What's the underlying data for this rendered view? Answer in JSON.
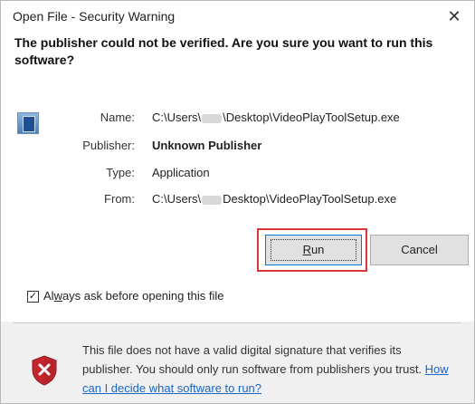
{
  "window": {
    "title": "Open File - Security Warning",
    "close_glyph": "✕"
  },
  "headline": "The publisher could not be verified.  Are you sure you want to run this software?",
  "info": {
    "name_label": "Name:",
    "name_prefix": "C:\\Users\\",
    "name_suffix": "\\Desktop\\VideoPlayToolSetup.exe",
    "publisher_label": "Publisher:",
    "publisher_value": "Unknown Publisher",
    "type_label": "Type:",
    "type_value": "Application",
    "from_label": "From:",
    "from_prefix": "C:\\Users\\",
    "from_suffix": "Desktop\\VideoPlayToolSetup.exe"
  },
  "buttons": {
    "run_accel": "R",
    "run_rest": "un",
    "cancel_label": "Cancel"
  },
  "checkbox": {
    "checked_glyph": "✓",
    "label_part1": "Al",
    "label_accel": "w",
    "label_part2": "ays ask before opening this file"
  },
  "warning": {
    "text": "This file does not have a valid digital signature that verifies its publisher.  You should only run software from publishers you trust.",
    "link": "How can I decide what software to run?"
  },
  "colors": {
    "highlight": "#e23636",
    "link": "#1a66c7",
    "shield_red": "#c4262e"
  },
  "icons": {
    "app": "application-icon",
    "warning": "shield-warning-icon",
    "close": "close-icon"
  }
}
